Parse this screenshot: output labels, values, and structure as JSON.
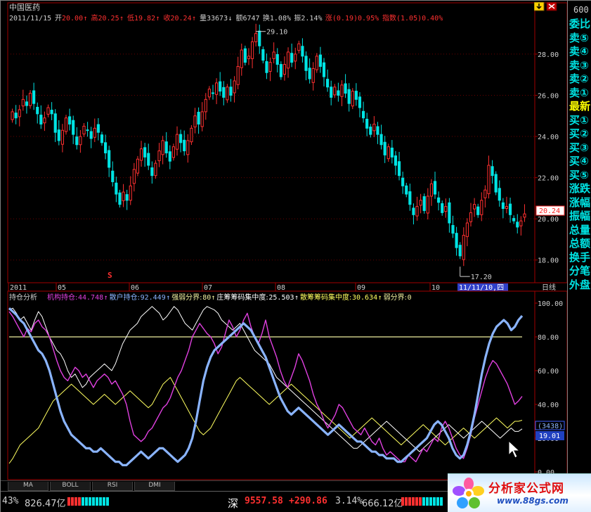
{
  "header": {
    "stock_name": "中国医药",
    "date": "2011/11/15",
    "open_label": "开",
    "open": "20.00",
    "high_label": "高",
    "high": "20.25",
    "low_label": "低",
    "low": "19.82",
    "close_label": "收",
    "close": "20.24",
    "volume_label": "量",
    "volume": "33673",
    "amount_label": "额",
    "amount": "6747",
    "turnover_label": "换",
    "turnover": "1.08%",
    "amplitude_label": "振",
    "amplitude": "2.14%",
    "change_label": "涨",
    "change": "(0.19)0.95%",
    "index_label": "指数",
    "index": "(1.05)0.40%"
  },
  "price_chart": {
    "y_ticks": [
      "28.00",
      "26.00",
      "24.00",
      "22.00",
      "20.00",
      "18.00"
    ],
    "max_label": "29.10",
    "min_label": "17.20",
    "last_price_tag": "20.24",
    "signal_mark": "S",
    "x_labels": [
      "2011",
      "05",
      "06",
      "07",
      "08",
      "09",
      "10"
    ],
    "selected_date": "11/11/10,四",
    "period": "日线"
  },
  "indicator": {
    "title": "持仓分析",
    "items": [
      {
        "label": "机构持仓:",
        "value": "44.748",
        "color": "#e040e0"
      },
      {
        "label": "散户持仓:",
        "value": "92.449",
        "color": "#8ab4ff"
      },
      {
        "label": "强弱分界:",
        "value": "80",
        "color": "#f0f0a0"
      },
      {
        "label": "庄筹筹码集中度:",
        "value": "25.503",
        "color": "#ffffff"
      },
      {
        "label": "散筹筹码集中度:",
        "value": "30.634",
        "color": "#ffff60"
      },
      {
        "label": "弱分界:",
        "value": "0",
        "color": "#f0f0a0"
      }
    ],
    "y_ticks": [
      "100.00",
      "80.00",
      "60.00",
      "40.00",
      "20.00",
      "0.00"
    ],
    "box_top": "(3438)",
    "box_bottom": "19.01"
  },
  "tabs": [
    "MA",
    "BOLL",
    "RSI",
    "DMI"
  ],
  "status": {
    "left_pct": "43%",
    "left_amount": "826.47亿",
    "market": "深",
    "index_value": "9557.58",
    "index_change": "+290.86",
    "index_pct": "3.14%",
    "index_amount": "666.12亿"
  },
  "side_panel": {
    "code": "600",
    "items": [
      "委比",
      "卖⑤",
      "卖④",
      "卖③",
      "卖②",
      "卖①",
      "最新",
      "买①",
      "买②",
      "买③",
      "买④",
      "买⑤",
      "涨跌",
      "涨幅",
      "振幅",
      "总量",
      "总额",
      "换手",
      "分笔",
      "外盘"
    ]
  },
  "logo": {
    "title": "分析家公式网",
    "url": "www.88gs.com"
  },
  "colors": {
    "up": "#ff3030",
    "down": "#00e4e4",
    "grid": "#8b0000",
    "axis": "#a00000",
    "institutional": "#e040e0",
    "retail": "#8ab4ff",
    "threshold": "#f0f0a0",
    "zhuang_conc": "#ffffff",
    "san_conc": "#ffff60"
  },
  "chart_data": [
    {
      "type": "candlestick",
      "title": "中国医药",
      "ylim": [
        17,
        29.5
      ],
      "x_labels": [
        "2011",
        "05",
        "06",
        "07",
        "08",
        "09",
        "10"
      ],
      "closes": [
        25.2,
        24.9,
        25.3,
        25.8,
        25.5,
        26.1,
        25.6,
        25.1,
        24.6,
        24.9,
        25.4,
        25.1,
        24.2,
        23.8,
        24.3,
        24.9,
        24.6,
        24.1,
        23.6,
        24.0,
        24.5,
        24.3,
        23.9,
        24.4,
        24.2,
        23.7,
        23.2,
        22.5,
        21.8,
        21.2,
        20.7,
        21.3,
        20.9,
        21.6,
        22.4,
        22.9,
        23.4,
        23.0,
        22.6,
        22.1,
        22.7,
        23.3,
        23.8,
        23.2,
        22.8,
        23.5,
        24.1,
        23.7,
        23.3,
        23.8,
        24.4,
        25.0,
        24.6,
        25.2,
        25.8,
        26.3,
        26.1,
        26.6,
        26.2,
        25.9,
        26.4,
        26.0,
        26.7,
        27.4,
        28.2,
        27.6,
        27.9,
        28.6,
        29.0,
        28.4,
        27.7,
        27.1,
        27.6,
        28.1,
        27.5,
        26.9,
        27.5,
        28.1,
        27.6,
        28.0,
        28.5,
        27.9,
        27.2,
        26.8,
        27.3,
        27.9,
        27.4,
        26.9,
        26.4,
        25.9,
        26.4,
        26.0,
        26.5,
        26.1,
        25.6,
        26.2,
        25.8,
        25.4,
        24.9,
        24.4,
        24.1,
        24.6,
        24.1,
        23.6,
        23.1,
        23.5,
        23.0,
        22.6,
        22.1,
        21.6,
        21.2,
        20.7,
        20.2,
        20.6,
        20.9,
        20.4,
        21.1,
        21.7,
        21.2,
        20.8,
        20.3,
        20.6,
        19.8,
        19.3,
        18.6,
        18.2,
        19.2,
        19.8,
        20.3,
        20.7,
        20.2,
        20.9,
        21.4,
        22.6,
        22.1,
        21.3,
        20.9,
        20.5,
        20.6,
        20.2,
        19.9,
        19.6,
        19.9,
        20.24
      ],
      "max_marker": 29.1,
      "min_marker": 17.2
    },
    {
      "type": "line",
      "title": "持仓分析",
      "ylim": [
        0,
        100
      ],
      "series": [
        {
          "name": "机构持仓",
          "values": [
            95,
            92,
            88,
            84,
            80,
            85,
            83,
            88,
            90,
            86,
            84,
            80,
            73,
            66,
            60,
            56,
            54,
            58,
            62,
            60,
            56,
            58,
            54,
            50,
            54,
            56,
            58,
            56,
            52,
            54,
            50,
            46,
            40,
            30,
            22,
            20,
            18,
            20,
            24,
            26,
            30,
            34,
            38,
            40,
            44,
            50,
            56,
            60,
            66,
            72,
            80,
            84,
            88,
            85,
            82,
            80,
            76,
            70,
            74,
            82,
            90,
            86,
            80,
            84,
            90,
            94,
            86,
            80,
            76,
            82,
            90,
            80,
            74,
            68,
            60,
            54,
            50,
            56,
            62,
            70,
            66,
            60,
            54,
            46,
            40,
            36,
            30,
            26,
            30,
            34,
            40,
            38,
            34,
            30,
            26,
            24,
            22,
            26,
            22,
            18,
            16,
            20,
            14,
            10,
            12,
            10,
            8,
            6,
            6,
            10,
            8,
            6,
            10,
            14,
            12,
            16,
            20,
            18,
            26,
            30,
            26,
            20,
            14,
            10,
            8,
            14,
            22,
            32,
            40,
            48,
            56,
            62,
            66,
            64,
            60,
            56,
            52,
            46,
            40,
            42,
            44.748
          ]
        },
        {
          "name": "散户持仓",
          "values": [
            97,
            95,
            93,
            90,
            88,
            84,
            80,
            76,
            72,
            70,
            66,
            60,
            52,
            44,
            36,
            30,
            26,
            22,
            20,
            18,
            16,
            14,
            14,
            12,
            12,
            14,
            12,
            10,
            8,
            6,
            6,
            4,
            4,
            6,
            8,
            10,
            12,
            10,
            8,
            10,
            12,
            14,
            14,
            12,
            10,
            8,
            6,
            8,
            10,
            14,
            20,
            30,
            42,
            54,
            62,
            68,
            72,
            74,
            76,
            78,
            80,
            82,
            84,
            86,
            88,
            86,
            84,
            80,
            76,
            72,
            68,
            62,
            56,
            50,
            44,
            40,
            36,
            34,
            36,
            38,
            36,
            34,
            32,
            30,
            28,
            26,
            24,
            22,
            24,
            26,
            28,
            26,
            24,
            22,
            20,
            18,
            18,
            16,
            14,
            12,
            12,
            10,
            10,
            8,
            8,
            8,
            6,
            6,
            8,
            10,
            12,
            14,
            16,
            18,
            20,
            24,
            28,
            30,
            28,
            24,
            20,
            14,
            10,
            8,
            10,
            16,
            24,
            34,
            46,
            58,
            68,
            76,
            82,
            86,
            88,
            90,
            88,
            84,
            86,
            90,
            92.449
          ]
        },
        {
          "name": "强弱分界",
          "values": [
            80,
            80
          ]
        },
        {
          "name": "庄筹筹码集中度",
          "values": [
            96,
            97,
            94,
            90,
            92,
            88,
            84,
            90,
            95,
            92,
            86,
            80,
            76,
            72,
            70,
            66,
            60,
            56,
            58,
            54,
            50,
            52,
            56,
            58,
            60,
            62,
            64,
            62,
            60,
            64,
            70,
            76,
            80,
            84,
            86,
            88,
            92,
            94,
            96,
            98,
            96,
            94,
            90,
            92,
            95,
            98,
            96,
            92,
            88,
            86,
            84,
            88,
            92,
            96,
            98,
            97,
            96,
            94,
            90,
            88,
            86,
            84,
            86,
            88,
            84,
            80,
            76,
            72,
            70,
            68,
            66,
            64,
            60,
            56,
            54,
            52,
            50,
            48,
            46,
            44,
            42,
            40,
            38,
            36,
            34,
            32,
            30,
            28,
            26,
            24,
            22,
            20,
            18,
            16,
            14,
            14,
            16,
            18,
            20,
            22,
            24,
            26,
            28,
            30,
            28,
            26,
            24,
            22,
            20,
            18,
            16,
            14,
            12,
            14,
            16,
            18,
            20,
            22,
            24,
            26,
            28,
            26,
            24,
            22,
            20,
            22,
            24,
            26,
            28,
            30,
            28,
            26,
            24,
            22,
            20,
            22,
            24,
            26,
            24,
            24,
            25.503
          ]
        },
        {
          "name": "散筹筹码集中度",
          "values": [
            5,
            8,
            12,
            16,
            18,
            20,
            22,
            24,
            26,
            30,
            34,
            38,
            42,
            44,
            46,
            48,
            50,
            52,
            50,
            48,
            46,
            44,
            42,
            40,
            42,
            44,
            46,
            44,
            42,
            40,
            42,
            44,
            46,
            48,
            46,
            44,
            42,
            40,
            38,
            40,
            44,
            48,
            52,
            54,
            56,
            52,
            48,
            44,
            40,
            36,
            32,
            28,
            24,
            22,
            24,
            26,
            30,
            34,
            38,
            42,
            46,
            50,
            54,
            56,
            54,
            52,
            50,
            48,
            46,
            44,
            42,
            40,
            42,
            44,
            46,
            48,
            50,
            52,
            50,
            48,
            46,
            44,
            42,
            40,
            38,
            36,
            34,
            32,
            30,
            28,
            26,
            24,
            22,
            20,
            22,
            24,
            26,
            28,
            30,
            32,
            30,
            28,
            26,
            24,
            22,
            20,
            18,
            16,
            18,
            20,
            22,
            24,
            26,
            28,
            26,
            24,
            22,
            20,
            18,
            16,
            18,
            20,
            22,
            24,
            26,
            24,
            22,
            20,
            22,
            24,
            26,
            28,
            30,
            32,
            30,
            28,
            26,
            28,
            30,
            30,
            30.634
          ]
        }
      ]
    }
  ]
}
